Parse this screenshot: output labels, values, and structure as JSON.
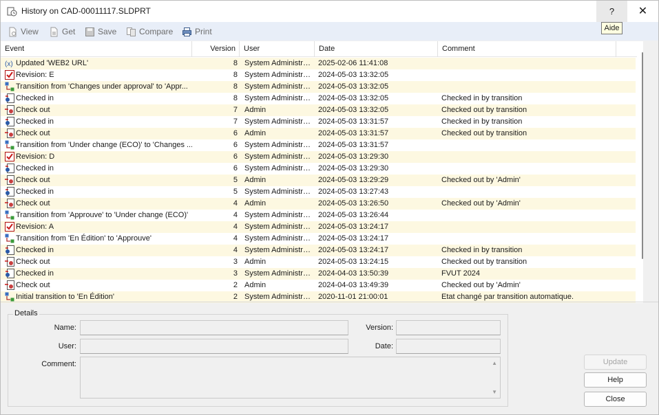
{
  "window": {
    "title": "History on CAD-00011117.SLDPRT",
    "help_label": "?",
    "close_label": "✕",
    "tooltip": "Aide"
  },
  "toolbar": {
    "view": "View",
    "get": "Get",
    "save": "Save",
    "compare": "Compare",
    "print": "Print"
  },
  "grid": {
    "columns": [
      "Event",
      "Version",
      "User",
      "Date",
      "Comment"
    ],
    "rows": [
      {
        "icon": "variable-icon",
        "event": "Updated 'WEB2 URL'",
        "version": "8",
        "user": "System Administrator",
        "date": "2025-02-06 11:41:08",
        "comment": ""
      },
      {
        "icon": "revision-icon",
        "event": "Revision: E",
        "version": "8",
        "user": "System Administrator",
        "date": "2024-05-03 13:32:05",
        "comment": ""
      },
      {
        "icon": "transition-icon",
        "event": "Transition from 'Changes under approval' to 'Appr...",
        "version": "8",
        "user": "System Administrator",
        "date": "2024-05-03 13:32:05",
        "comment": ""
      },
      {
        "icon": "checkin-icon",
        "event": "Checked in",
        "version": "8",
        "user": "System Administrator",
        "date": "2024-05-03 13:32:05",
        "comment": "Checked in by transition"
      },
      {
        "icon": "checkout-icon",
        "event": "Check out",
        "version": "7",
        "user": "Admin",
        "date": "2024-05-03 13:32:05",
        "comment": "Checked out by transition"
      },
      {
        "icon": "checkin-icon",
        "event": "Checked in",
        "version": "7",
        "user": "System Administrator",
        "date": "2024-05-03 13:31:57",
        "comment": "Checked in by transition"
      },
      {
        "icon": "checkout-icon",
        "event": "Check out",
        "version": "6",
        "user": "Admin",
        "date": "2024-05-03 13:31:57",
        "comment": "Checked out by transition"
      },
      {
        "icon": "transition-icon",
        "event": "Transition from 'Under change (ECO)' to 'Changes ...",
        "version": "6",
        "user": "System Administrator",
        "date": "2024-05-03 13:31:57",
        "comment": ""
      },
      {
        "icon": "revision-icon",
        "event": "Revision: D",
        "version": "6",
        "user": "System Administrator",
        "date": "2024-05-03 13:29:30",
        "comment": ""
      },
      {
        "icon": "checkin-icon",
        "event": "Checked in",
        "version": "6",
        "user": "System Administrator",
        "date": "2024-05-03 13:29:30",
        "comment": ""
      },
      {
        "icon": "checkout-icon",
        "event": "Check out",
        "version": "5",
        "user": "Admin",
        "date": "2024-05-03 13:29:29",
        "comment": "Checked out by 'Admin'"
      },
      {
        "icon": "checkin-icon",
        "event": "Checked in",
        "version": "5",
        "user": "System Administrator",
        "date": "2024-05-03 13:27:43",
        "comment": ""
      },
      {
        "icon": "checkout-icon",
        "event": "Check out",
        "version": "4",
        "user": "Admin",
        "date": "2024-05-03 13:26:50",
        "comment": "Checked out by 'Admin'"
      },
      {
        "icon": "transition-icon",
        "event": "Transition from 'Approuve' to 'Under change (ECO)'",
        "version": "4",
        "user": "System Administrator",
        "date": "2024-05-03 13:26:44",
        "comment": ""
      },
      {
        "icon": "revision-icon",
        "event": "Revision: A",
        "version": "4",
        "user": "System Administrator",
        "date": "2024-05-03 13:24:17",
        "comment": ""
      },
      {
        "icon": "transition-icon",
        "event": "Transition from 'En Édition' to 'Approuve'",
        "version": "4",
        "user": "System Administrator",
        "date": "2024-05-03 13:24:17",
        "comment": ""
      },
      {
        "icon": "checkin-icon",
        "event": "Checked in",
        "version": "4",
        "user": "System Administrator",
        "date": "2024-05-03 13:24:17",
        "comment": "Checked in by transition"
      },
      {
        "icon": "checkout-icon",
        "event": "Check out",
        "version": "3",
        "user": "Admin",
        "date": "2024-05-03 13:24:15",
        "comment": "Checked out by transition"
      },
      {
        "icon": "checkin-icon",
        "event": "Checked in",
        "version": "3",
        "user": "System Administrator",
        "date": "2024-04-03 13:50:39",
        "comment": "FVUT 2024"
      },
      {
        "icon": "checkout-icon",
        "event": "Check out",
        "version": "2",
        "user": "Admin",
        "date": "2024-04-03 13:49:39",
        "comment": "Checked out by 'Admin'"
      },
      {
        "icon": "transition-icon",
        "event": "Initial transition to 'En Édition'",
        "version": "2",
        "user": "System Administrator",
        "date": "2020-11-01 21:00:01",
        "comment": "Etat changé par transition automatique."
      }
    ]
  },
  "details": {
    "legend": "Details",
    "name_label": "Name:",
    "version_label": "Version:",
    "user_label": "User:",
    "date_label": "Date:",
    "comment_label": "Comment:",
    "name_value": "",
    "version_value": "",
    "user_value": "",
    "date_value": "",
    "comment_value": ""
  },
  "buttons": {
    "update": "Update",
    "help": "Help",
    "close": "Close"
  }
}
